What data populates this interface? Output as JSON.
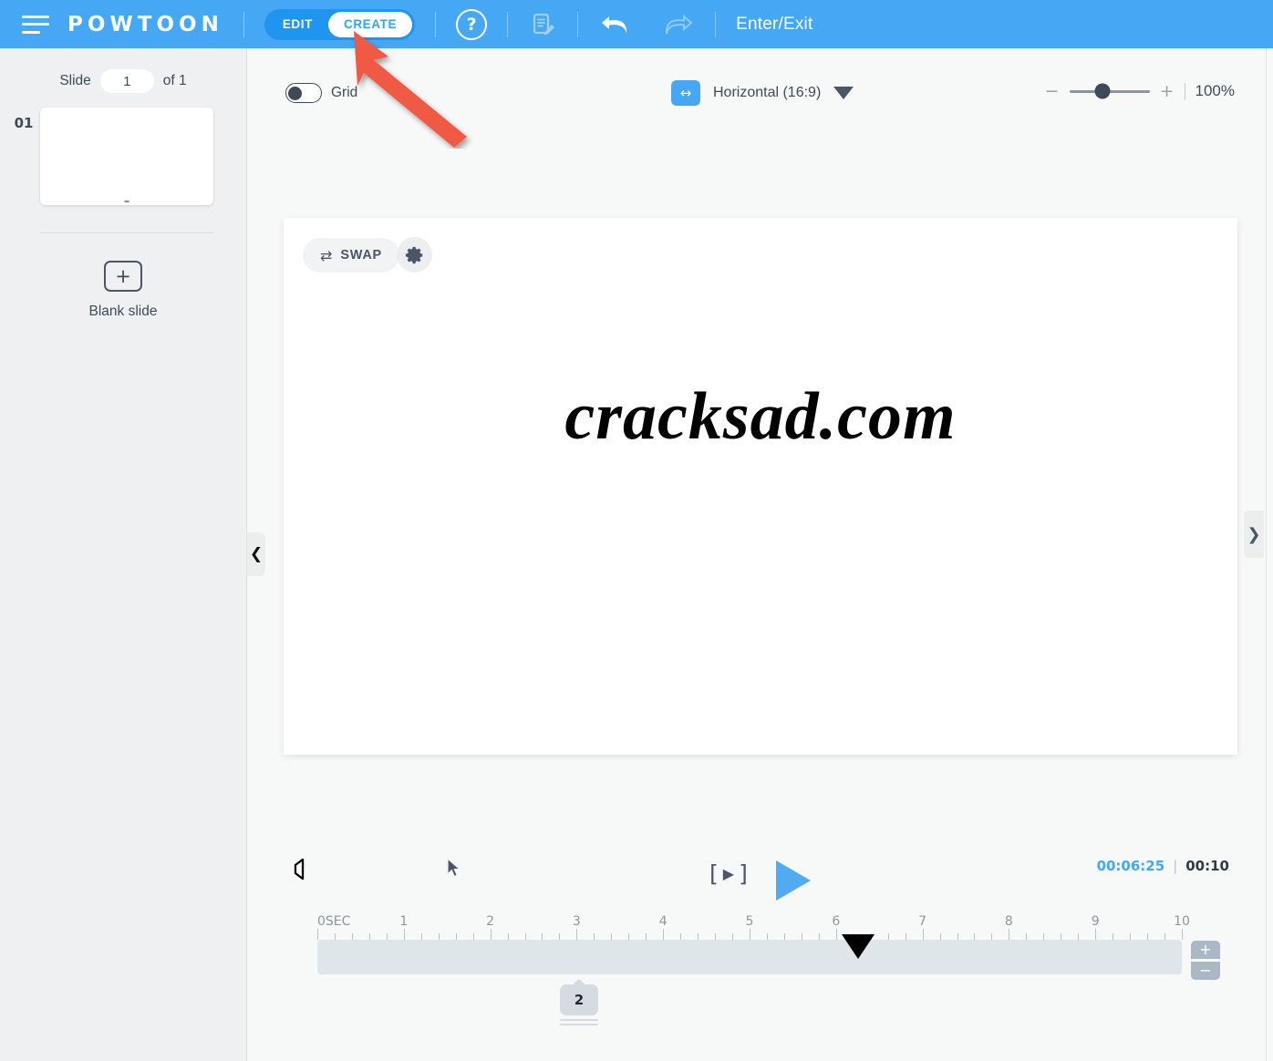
{
  "topbar": {
    "menu_icon": "hamburger-menu-icon",
    "brand": "POWTOON",
    "mode_tabs": [
      {
        "label": "EDIT",
        "active": false
      },
      {
        "label": "CREATE",
        "active": true
      }
    ],
    "help_icon_label": "?",
    "notes_icon": "document-edit-icon",
    "undo_icon": "undo-arrow-icon",
    "redo_icon": "redo-arrow-icon",
    "enter_exit_label": "Enter/Exit",
    "bar_color": "#46a7f5",
    "active_tab_text_color": "#36a2f2"
  },
  "left_panel": {
    "slide_label": "Slide",
    "slide_number": "1",
    "slide_total_label": "of 1",
    "thumbnail_number": "01",
    "add_slide_icon": "+",
    "add_slide_label": "Blank slide"
  },
  "stage_toolbar": {
    "grid_label": "Grid",
    "grid_enabled": false,
    "orientation_icon": "horizontal-arrows-icon",
    "orientation_label": "Horizontal (16:9)",
    "orientation_caret": "chevron-down-icon",
    "zoom_minus": "−",
    "zoom_plus": "+",
    "zoom_value": "100%"
  },
  "canvas": {
    "swap_icon": "⇄",
    "swap_label": "SWAP",
    "settings_icon": "gear-icon",
    "text": "cracksad.com"
  },
  "playback": {
    "sound_icon": "speaker-icon",
    "cursor_icon": "mouse-pointer-icon",
    "play_slide_open": "[",
    "play_slide_icon": "▶",
    "play_slide_close": "]",
    "play_icon": "play-triangle-icon",
    "current_time": "00:06:25",
    "time_separator": "|",
    "total_time": "00:10",
    "current_time_color": "#46a7f5"
  },
  "timeline": {
    "ruler_labels": [
      "0SEC",
      "1",
      "2",
      "3",
      "4",
      "5",
      "6",
      "7",
      "8",
      "9",
      "10"
    ],
    "playhead_position_seconds": 6.25,
    "scene_marker_label": "2",
    "zoom_in": "+",
    "zoom_out": "−",
    "track_color": "#dfe6e9"
  },
  "panel_toggles": {
    "left_collapse_icon": "chevron-left-icon",
    "right_expand_icon": "chevron-right-icon"
  },
  "annotation": {
    "arrow_color": "#f05a45",
    "points_to": "CREATE"
  }
}
